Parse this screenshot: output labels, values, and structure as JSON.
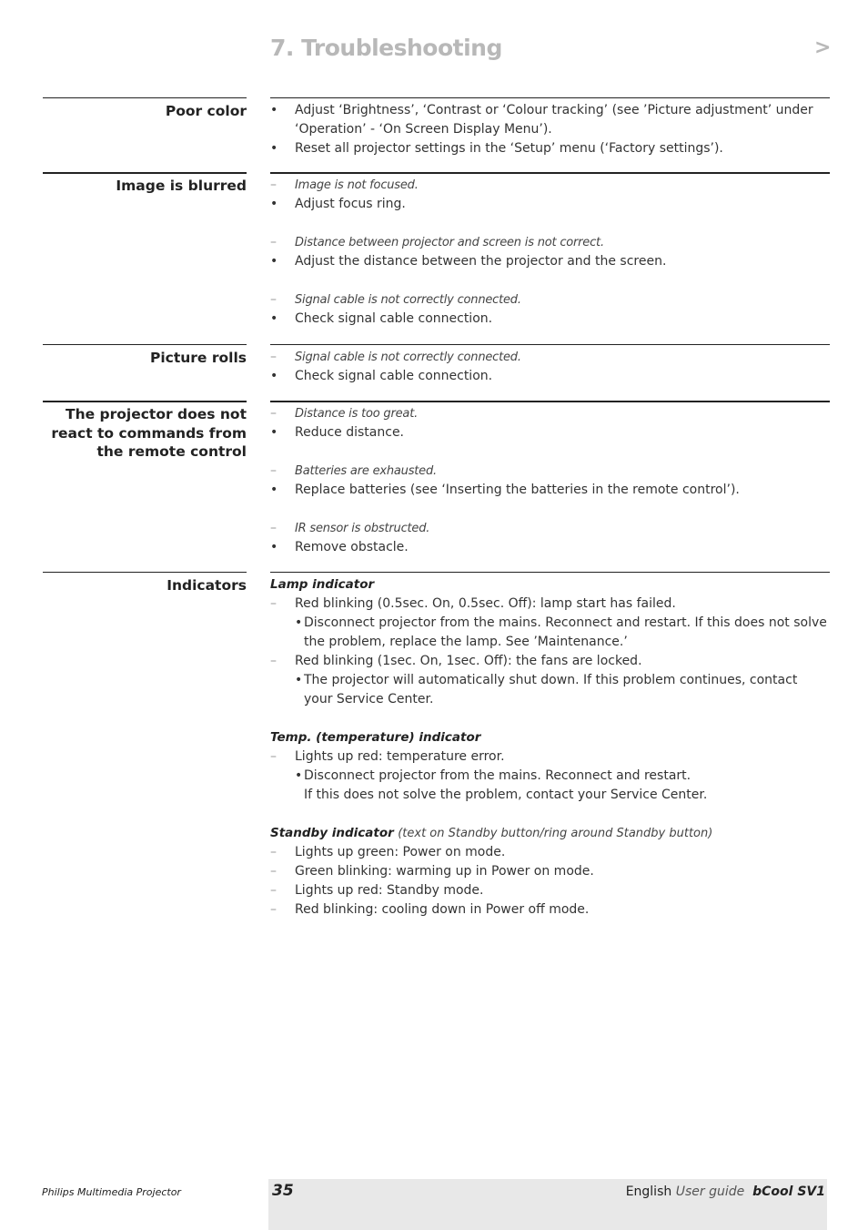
{
  "header": {
    "title": "7. Troubleshooting",
    "next_arrow": ">"
  },
  "sections": [
    {
      "heading": "Poor color",
      "items": [
        {
          "type": "bullet",
          "text": "Adjust ‘Brightness’, ‘Contrast or ‘Colour tracking’ (see ’Picture adjustment’ under ‘Operation’ - ‘On Screen Display Menu’)."
        },
        {
          "type": "bullet",
          "text": "Reset all projector settings in the ‘Setup’ menu (‘Factory settings’)."
        }
      ]
    },
    {
      "heading": "Image is blurred",
      "items": [
        {
          "type": "cause",
          "text": "Image is not focused."
        },
        {
          "type": "bullet",
          "text": "Adjust focus ring."
        },
        {
          "type": "cause",
          "text": "Distance between projector and screen is not correct."
        },
        {
          "type": "bullet",
          "text": "Adjust the distance between the projector and the screen."
        },
        {
          "type": "cause",
          "text": "Signal cable is not correctly connected."
        },
        {
          "type": "bullet",
          "text": "Check signal cable connection."
        }
      ]
    },
    {
      "heading": "Picture rolls",
      "items": [
        {
          "type": "cause",
          "text": "Signal cable is not correctly connected."
        },
        {
          "type": "bullet",
          "text": "Check signal cable connection."
        }
      ]
    },
    {
      "heading_lines": [
        "The projector does not",
        "react to commands from",
        "the remote control"
      ],
      "items": [
        {
          "type": "cause",
          "text": "Distance is too great."
        },
        {
          "type": "bullet",
          "text": "Reduce distance."
        },
        {
          "type": "cause",
          "text": "Batteries are exhausted."
        },
        {
          "type": "bullet",
          "text": "Replace batteries (see ‘Inserting the batteries in the remote control’)."
        },
        {
          "type": "cause",
          "text": "IR sensor is obstructed."
        },
        {
          "type": "bullet",
          "text": "Remove obstacle."
        }
      ]
    },
    {
      "heading": "Indicators",
      "groups": [
        {
          "title": "Lamp indicator",
          "lines": [
            {
              "type": "dash",
              "text": "Red blinking (0.5sec. On, 0.5sec. Off): lamp start has failed."
            },
            {
              "type": "sub",
              "text": "Disconnect projector from the mains. Reconnect and restart. If this does not solve the problem, replace the lamp. See ’Maintenance.’"
            },
            {
              "type": "dash",
              "text": "Red blinking (1sec. On, 1sec. Off): the fans are locked."
            },
            {
              "type": "sub",
              "text": "The projector will automatically shut down. If this problem continues, contact your Service Center."
            }
          ]
        },
        {
          "title": "Temp. (temperature) indicator",
          "lines": [
            {
              "type": "dash",
              "text": "Lights up red: temperature error."
            },
            {
              "type": "sub",
              "text": "Disconnect projector from the mains. Reconnect and restart."
            },
            {
              "type": "cont",
              "text": "If this does not solve the problem, contact your Service Center."
            }
          ]
        },
        {
          "title": "Standby indicator",
          "note": "(text on Standby button/ring around Standby button)",
          "lines": [
            {
              "type": "dash",
              "text": "Lights up green: Power on mode."
            },
            {
              "type": "dash",
              "text": "Green blinking: warming up in Power on mode."
            },
            {
              "type": "dash",
              "text": "Lights up red: Standby mode."
            },
            {
              "type": "dash",
              "text": "Red blinking: cooling down in Power off mode."
            }
          ]
        }
      ]
    }
  ],
  "markers": {
    "bullet": "•",
    "dash": "–"
  },
  "footer": {
    "product": "Philips Multimedia Projector",
    "page_number": "35",
    "language": "English",
    "guide": "User guide",
    "model": "bCool SV1"
  }
}
